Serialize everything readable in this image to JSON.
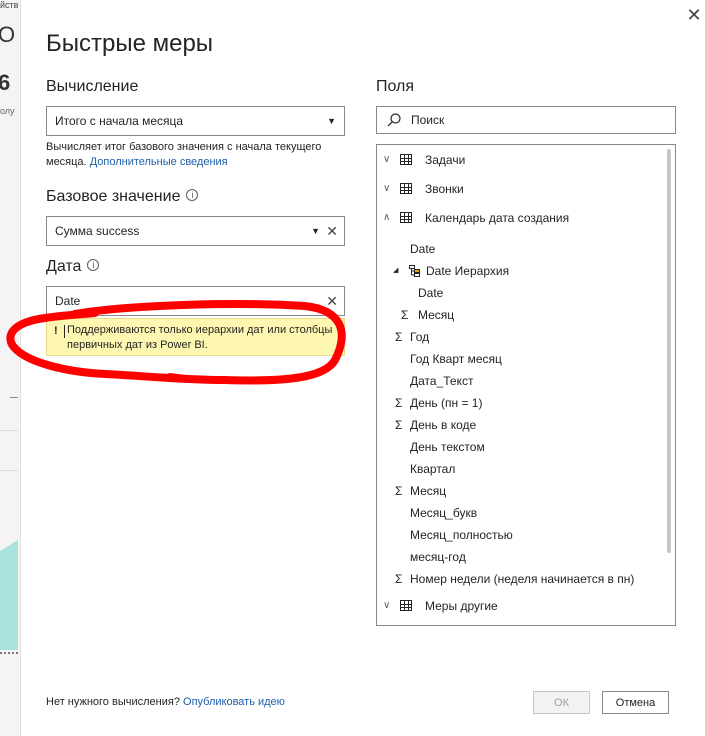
{
  "background": {
    "t1": "йств",
    "t2": "О",
    "t3": "6",
    "t4": "олу"
  },
  "dialog": {
    "title": "Быстрые меры",
    "close_icon": "close-icon",
    "calculation": {
      "label": "Вычисление",
      "selected": "Итого с начала месяца",
      "description": "Вычисляет итог базового значения с начала текущего месяца.",
      "more_link": "Дополнительные сведения"
    },
    "base_value": {
      "label": "Базовое значение",
      "selected": "Сумма success"
    },
    "date": {
      "label": "Дата",
      "value": "Date",
      "warning": "Поддерживаются только иерархии дат или столбцы первичных дат из Power BI.",
      "warning_icon": "!"
    },
    "fields": {
      "label": "Поля",
      "search_placeholder": "Поиск",
      "items": [
        {
          "label": "Задачи",
          "kind": "table",
          "state": "collapsed"
        },
        {
          "label": "Звонки",
          "kind": "table",
          "state": "collapsed"
        },
        {
          "label": "Календарь дата создания",
          "kind": "table",
          "state": "expanded"
        },
        {
          "label": "Date",
          "kind": "field"
        },
        {
          "label": "Date Иерархия",
          "kind": "hierarchy"
        },
        {
          "label": "Date",
          "kind": "field"
        },
        {
          "label": "Месяц",
          "kind": "sum"
        },
        {
          "label": "Год",
          "kind": "sum"
        },
        {
          "label": "Год Кварт месяц",
          "kind": "field"
        },
        {
          "label": "Дата_Текст",
          "kind": "field"
        },
        {
          "label": "День (пн = 1)",
          "kind": "sum"
        },
        {
          "label": "День в коде",
          "kind": "sum"
        },
        {
          "label": "День текстом",
          "kind": "field"
        },
        {
          "label": "Квартал",
          "kind": "field"
        },
        {
          "label": "Месяц",
          "kind": "sum"
        },
        {
          "label": "Месяц_букв",
          "kind": "field"
        },
        {
          "label": "Месяц_полностью",
          "kind": "field"
        },
        {
          "label": "месяц-год",
          "kind": "field"
        },
        {
          "label": "Номер недели (неделя начинается в пн)",
          "kind": "sum"
        },
        {
          "label": "Меры другие",
          "kind": "table",
          "state": "collapsed"
        }
      ]
    },
    "footer": {
      "question": "Нет нужного вычисления?",
      "publish_link": "Опубликовать идею",
      "ok": "ОК",
      "cancel": "Отмена"
    },
    "glyphs": {
      "close": "✕",
      "dropdown": "▼",
      "clear": "✕",
      "chev_down": "∨",
      "chev_up": "∧",
      "expand_tri": "◢",
      "sigma": "Σ",
      "info": "i"
    }
  }
}
